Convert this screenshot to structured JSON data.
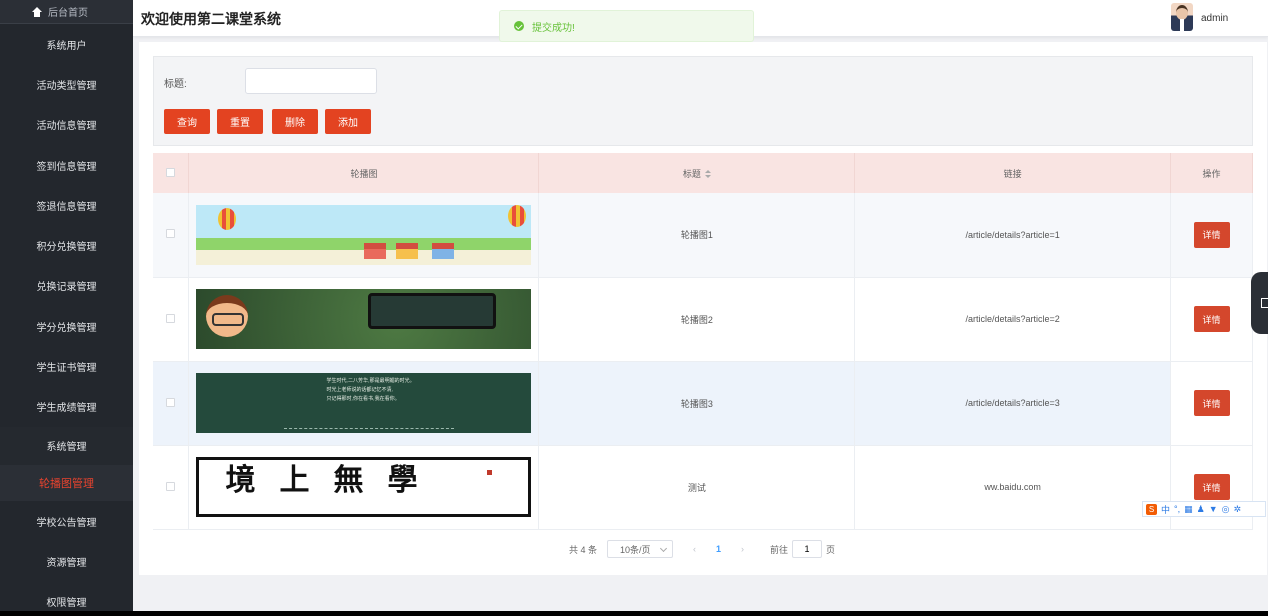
{
  "sidebar": {
    "home_label": "后台首页",
    "items": [
      {
        "label": "系统用户"
      },
      {
        "label": "活动类型管理"
      },
      {
        "label": "活动信息管理"
      },
      {
        "label": "签到信息管理"
      },
      {
        "label": "签退信息管理"
      },
      {
        "label": "积分兑换管理"
      },
      {
        "label": "兑换记录管理"
      },
      {
        "label": "学分兑换管理"
      },
      {
        "label": "学生证书管理"
      },
      {
        "label": "学生成绩管理"
      },
      {
        "label": "系统管理"
      },
      {
        "label": "轮播图管理"
      },
      {
        "label": "学校公告管理"
      },
      {
        "label": "资源管理"
      },
      {
        "label": "权限管理"
      }
    ]
  },
  "header": {
    "title": "欢迎使用第二课堂系统",
    "user": "admin"
  },
  "toast": {
    "message": "提交成功!"
  },
  "search": {
    "title_label": "标题:",
    "title_value": "",
    "query_label": "查询",
    "reset_label": "重置",
    "delete_label": "删除",
    "add_label": "添加"
  },
  "table": {
    "columns": [
      "轮播图",
      "标题",
      "链接",
      "操作"
    ],
    "rows": [
      {
        "title": "轮播图1",
        "link": "/article/details?article=1",
        "action": "详情"
      },
      {
        "title": "轮播图2",
        "link": "/article/details?article=2",
        "action": "详情"
      },
      {
        "title": "轮播图3",
        "link": "/article/details?article=3",
        "action": "详情"
      },
      {
        "title": "测试",
        "link": "ww.baidu.com",
        "action": "详情"
      }
    ],
    "banner3_text": [
      "学生时代,二八芳华,那是最明媚的时光。",
      "时光上老师说的话都记忆不清,",
      "只记得那时,你在看书,我在看你。"
    ],
    "banner4_calligraphy": "境上無學"
  },
  "pager": {
    "total": "共 4 条",
    "page_size": "10条/页",
    "prev": "‹",
    "current": "1",
    "next": "›",
    "goto_label": "前往",
    "goto_value": "1",
    "page_suffix": "页"
  },
  "ime": {
    "logo": "S",
    "mode": "中"
  },
  "colors": {
    "sidebar_bg": "#2b2f36",
    "accent": "#e34321",
    "active_menu": "#e8432e",
    "toast_green": "#67c23a",
    "table_header": "#f9e4e2"
  }
}
